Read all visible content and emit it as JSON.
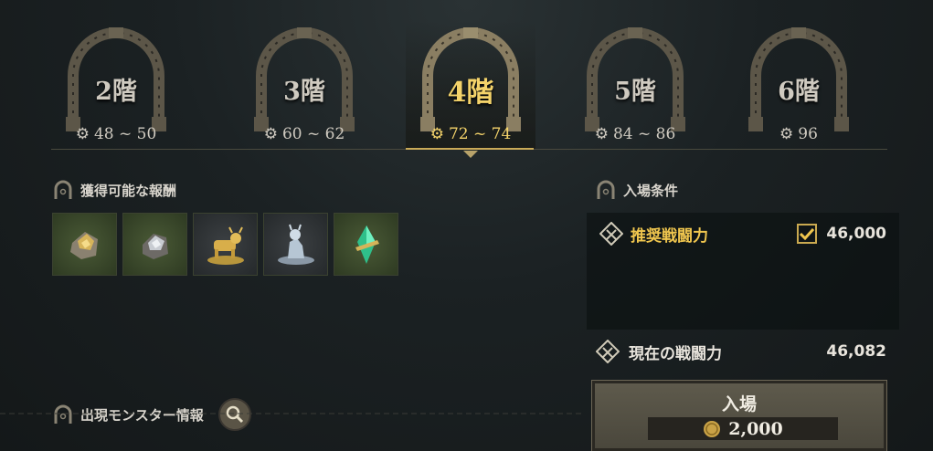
{
  "floors": [
    {
      "name": "2階",
      "level": "48 ~ 50",
      "selected": false
    },
    {
      "name": "3階",
      "level": "60 ~ 62",
      "selected": false
    },
    {
      "name": "4階",
      "level": "72 ~ 74",
      "selected": true
    },
    {
      "name": "5階",
      "level": "84 ~ 86",
      "selected": false
    },
    {
      "name": "6階",
      "level": "96",
      "selected": false
    }
  ],
  "rewards_section": {
    "title": "獲得可能な報酬",
    "items": [
      {
        "icon": "gold-ore-icon",
        "bg": "green"
      },
      {
        "icon": "silver-ore-icon",
        "bg": "green"
      },
      {
        "icon": "golden-bull-statue-icon",
        "bg": "gray"
      },
      {
        "icon": "silver-dog-statue-icon",
        "bg": "gray"
      },
      {
        "icon": "emerald-crystal-icon",
        "bg": "green"
      }
    ]
  },
  "monster_section": {
    "title": "出現モンスター情報"
  },
  "entry": {
    "title": "入場条件",
    "recommended_label": "推奨戦闘力",
    "recommended_value": "46,000",
    "recommended_met": true,
    "current_label": "現在の戦闘力",
    "current_value": "46,082",
    "button_label": "入場",
    "cost": "2,000"
  },
  "colors": {
    "accent": "#f4d36a",
    "gold": "#c9aa58"
  }
}
